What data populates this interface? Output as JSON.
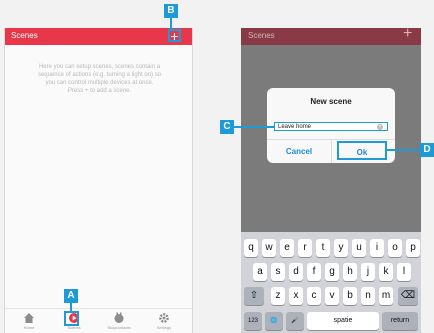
{
  "left_screen": {
    "title": "Scenes",
    "add_symbol": "+",
    "description": "Here you can setup scenes, scenes contain a sequence of actions (e.g. turning a light on) so you can control multiple devices at once. Press + to add a scene.",
    "tabs": [
      {
        "label": "Home",
        "icon": "home-icon"
      },
      {
        "label": "Scenes",
        "icon": "scenes-icon",
        "active": true
      },
      {
        "label": "Stopcontacts",
        "icon": "plug-icon"
      },
      {
        "label": "Settings",
        "icon": "gear-icon"
      }
    ]
  },
  "right_screen": {
    "title": "Scenes",
    "add_symbol": "+",
    "dialog": {
      "title": "New scene",
      "input_value": "Leave home",
      "clear_symbol": "×",
      "cancel_label": "Cancel",
      "ok_label": "Ok"
    },
    "keyboard": {
      "row1": [
        "q",
        "w",
        "e",
        "r",
        "t",
        "y",
        "u",
        "i",
        "o",
        "p"
      ],
      "row2": [
        "a",
        "s",
        "d",
        "f",
        "g",
        "h",
        "j",
        "k",
        "l"
      ],
      "row3": [
        "z",
        "x",
        "c",
        "v",
        "b",
        "n",
        "m"
      ],
      "shift_symbol": "⇧",
      "backspace_symbol": "⌫",
      "numbers_label": "123",
      "globe_symbol": "🌐",
      "mic_symbol": "🎤",
      "space_label": "spatie",
      "return_label": "return"
    }
  },
  "callouts": {
    "a": "A",
    "b": "B",
    "c": "C",
    "d": "D"
  },
  "colors": {
    "accent": "#e8364b",
    "highlight": "#1e9ad6",
    "overlay": "#7b7b7b"
  }
}
